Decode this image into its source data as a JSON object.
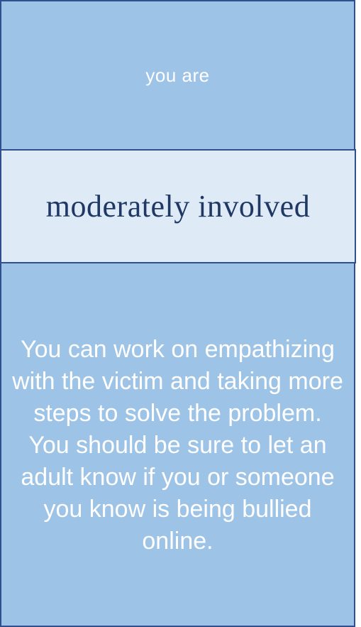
{
  "header": {
    "label": "you are"
  },
  "result": {
    "level": "moderately involved"
  },
  "feedback": {
    "message": "You can work on empathizing with the victim and taking more steps to solve the problem. You should be sure to let an adult know if you or someone you know is being bullied online."
  },
  "colors": {
    "panel_blue": "#9dc3e6",
    "panel_light": "#deebf7",
    "border": "#2f4f8f",
    "result_text": "#1f3864"
  }
}
